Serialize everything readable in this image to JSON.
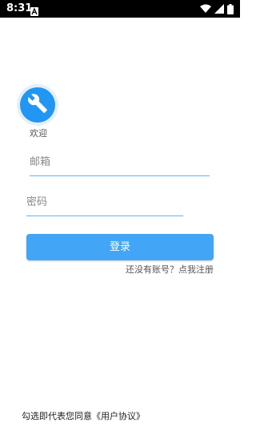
{
  "status_bar": {
    "time": "8:31",
    "app_icon": "notification-a-icon",
    "icons": [
      "wifi-icon",
      "signal-icon",
      "battery-icon"
    ]
  },
  "logo": {
    "icon": "wrench-icon",
    "welcome": "欢迎"
  },
  "form": {
    "email_placeholder": "邮箱",
    "password_placeholder": "密码",
    "login_label": "登录",
    "register_link": "还没有账号？点我注册"
  },
  "footer": {
    "agreement": "勾选即代表您同意《用户协议》"
  },
  "colors": {
    "primary": "#2196f3",
    "button": "#42a5f5",
    "underline": "#64b5f6",
    "status_bar": "#000000"
  }
}
